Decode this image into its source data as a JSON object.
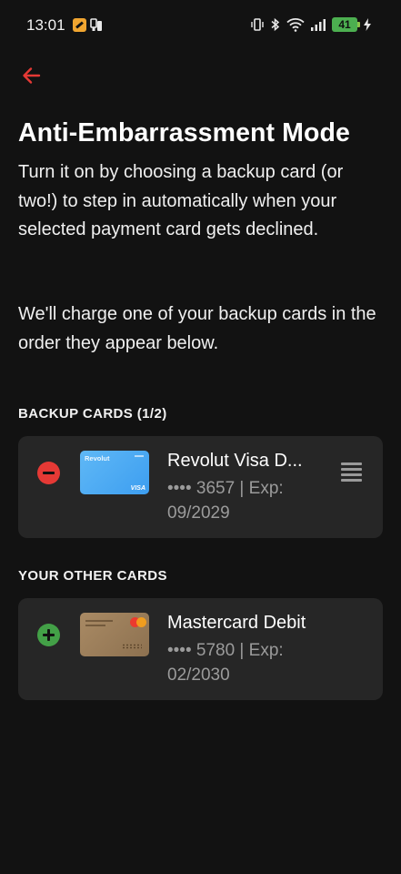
{
  "status_bar": {
    "time": "13:01",
    "battery": "41",
    "icons": [
      "app-notification-icon",
      "app-notification-icon",
      "vibrate-icon",
      "bluetooth-icon",
      "wifi-icon",
      "signal-icon",
      "battery-icon",
      "charging-icon"
    ]
  },
  "header": {
    "back_icon": "arrow-left-icon",
    "title": "Anti-Embarrassment Mode"
  },
  "description": {
    "paragraph1": "Turn it on by choosing a backup card (or two!) to step in automatically when your selected payment card gets declined.",
    "paragraph2": "We'll charge one of your backup cards in the order they appear below."
  },
  "backup_section": {
    "label": "BACKUP CARDS (1/2)",
    "cards": [
      {
        "name": "Revolut Visa D...",
        "meta": "•••• 3657 | Exp: 09/2029",
        "thumb_brand": "Revolut",
        "thumb_network": "VISA",
        "action_icon": "remove-circle-icon",
        "handle_icon": "drag-handle-icon"
      }
    ]
  },
  "other_section": {
    "label": "YOUR OTHER CARDS",
    "cards": [
      {
        "name": "Mastercard Debit",
        "meta": "•••• 5780 | Exp: 02/2030",
        "action_icon": "add-circle-icon"
      }
    ]
  },
  "colors": {
    "background": "#121212",
    "card_surface": "#262626",
    "accent_red": "#e53935",
    "accent_green": "#43a047",
    "battery_green": "#4caf50",
    "revolut_blue": "#4aa8f2"
  }
}
